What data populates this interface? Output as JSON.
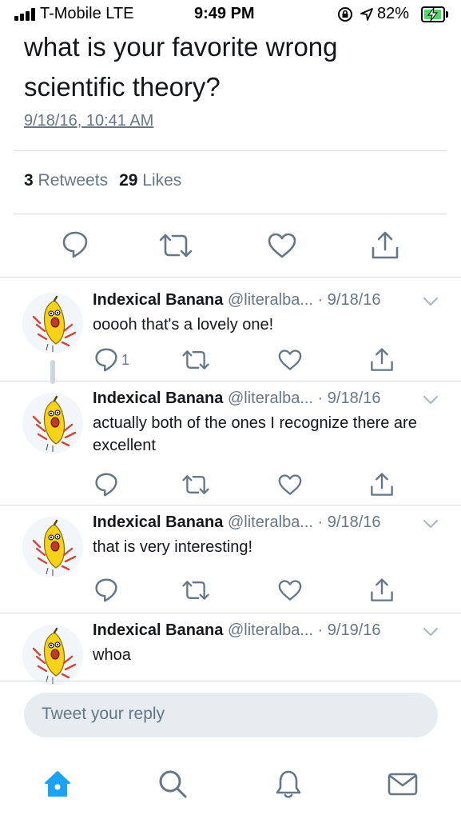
{
  "status_bar": {
    "carrier": "T-Mobile  LTE",
    "time": "9:49 PM",
    "battery_pct": "82%",
    "battery_level": 0.82,
    "battery_color": "#4cd964"
  },
  "tweet": {
    "text": "what is your favorite wrong scientific theory?",
    "date": "9/18/16, 10:41 AM",
    "retweets_count": "3",
    "retweets_label": "Retweets",
    "likes_count": "29",
    "likes_label": "Likes",
    "actions": [
      "reply-icon",
      "retweet-icon",
      "like-icon",
      "share-icon"
    ]
  },
  "replies": [
    {
      "name": "Indexical Banana",
      "handle": "@literalba...",
      "sep": "·",
      "date": "9/18/16",
      "text": "ooooh that's a lovely one!",
      "reply_count": "1"
    },
    {
      "name": "Indexical Banana",
      "handle": "@literalba...",
      "sep": "·",
      "date": "9/18/16",
      "text": "actually both of the ones I recognize there are excellent",
      "reply_count": ""
    },
    {
      "name": "Indexical Banana",
      "handle": "@literalba...",
      "sep": "·",
      "date": "9/18/16",
      "text": "that is very interesting!",
      "reply_count": ""
    },
    {
      "name": "Indexical Banana",
      "handle": "@literalba...",
      "sep": "·",
      "date": "9/19/16",
      "text": "whoa",
      "reply_count": ""
    }
  ],
  "composer": {
    "placeholder": "Tweet your reply"
  },
  "bottom_nav": {
    "items": [
      "home-icon",
      "search-icon",
      "notifications-icon",
      "messages-icon"
    ],
    "active": "home-icon",
    "accent": "#1da1f2"
  }
}
